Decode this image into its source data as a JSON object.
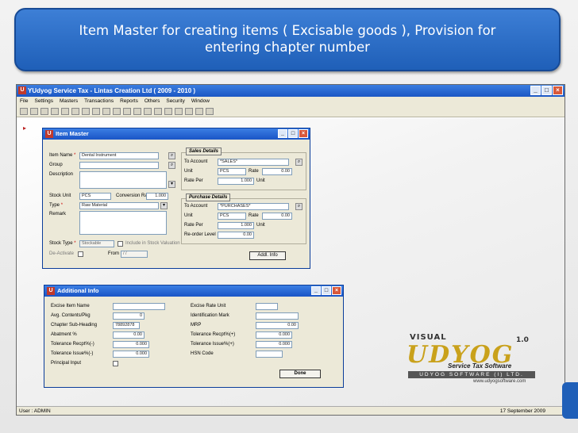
{
  "banner": {
    "line1": "Item Master for creating items ( Excisable goods ), Provision for",
    "line2": "entering chapter number"
  },
  "app": {
    "title": "YUdyog Service Tax - Lintas Creation Ltd ( 2009 - 2010 )",
    "menu": [
      "File",
      "Settings",
      "Masters",
      "Transactions",
      "Reports",
      "Others",
      "Security",
      "Window"
    ],
    "status_user": "User : ADMIN",
    "status_date": "17 September 2009"
  },
  "item_master": {
    "title": "Item Master",
    "item_name_label": "Item Name",
    "item_name": "Dental Instrument",
    "group_label": "Group",
    "description_label": "Description",
    "stock_unit_label": "Stock Unit",
    "stock_unit": "PCS",
    "conversion_ratio_label": "Conversion Ratio",
    "conversion_ratio": "1.000",
    "type_label": "Type",
    "type": "Raw Material",
    "remark_label": "Remark",
    "stock_type_label": "Stock Type",
    "stock_type": "Stockable",
    "include_label": "Include in Stock Valuation",
    "deactivate_label": "De-Activate",
    "from_label": "From",
    "from_value": "/  /",
    "addl_info_label": "Addl. Info",
    "sales": {
      "title": "Sales Details",
      "to_account_label": "To Account",
      "to_account": "*SALES*",
      "unit_label": "Unit",
      "unit": "PCS",
      "rate_label": "Rate",
      "rate": "0.00",
      "rate_per_label": "Rate Per",
      "rate_per": "1.000",
      "unit2_label": "Unit"
    },
    "purchase": {
      "title": "Purchase Details",
      "to_account_label": "To Account",
      "to_account": "*PURCHASES*",
      "unit_label": "Unit",
      "unit": "PCS",
      "rate_label": "Rate",
      "rate": "0.00",
      "rate_per_label": "Rate Per",
      "rate_per": "1.000",
      "unit2_label": "Unit",
      "reorder_label": "Re-order Level",
      "reorder": "0.00"
    }
  },
  "additional_info": {
    "title": "Additional Info",
    "excise_item_name_label": "Excise Item Name",
    "avg_contents_label": "Avg. Contents/Pkg",
    "avg_contents": "0",
    "chapter_sub_heading_label": "Chapter Sub-Heading",
    "chapter_sub_heading": "78892878",
    "abatment_label": "Abatment %",
    "abatment": "0.00",
    "tol_recpt_minus_label": "Tolerance Recpt%(-)",
    "tol_recpt_minus": "0.000",
    "tol_issue_minus_label": "Tolerance Issue%(-)",
    "tol_issue_minus": "0.000",
    "principal_input_label": "Principal Input",
    "excise_rate_unit_label": "Excise Rate Unit",
    "identification_mark_label": "Identification Mark",
    "mrp_label": "MRP",
    "mrp": "0.00",
    "tol_recpt_plus_label": "Tolerance Recpt%(+)",
    "tol_recpt_plus": "0.000",
    "tol_issue_plus_label": "Tolerance Issue%(+)",
    "tol_issue_plus": "0.000",
    "hsn_code_label": "HSN Code",
    "done_label": "Done"
  },
  "logo": {
    "visual": "VISUAL",
    "name": "UDYOG",
    "version": "1.0",
    "tagline": "Service Tax Software",
    "company": "UDYOG SOFTWARE (I) LTD.",
    "website": "www.udyogsoftware.com"
  }
}
